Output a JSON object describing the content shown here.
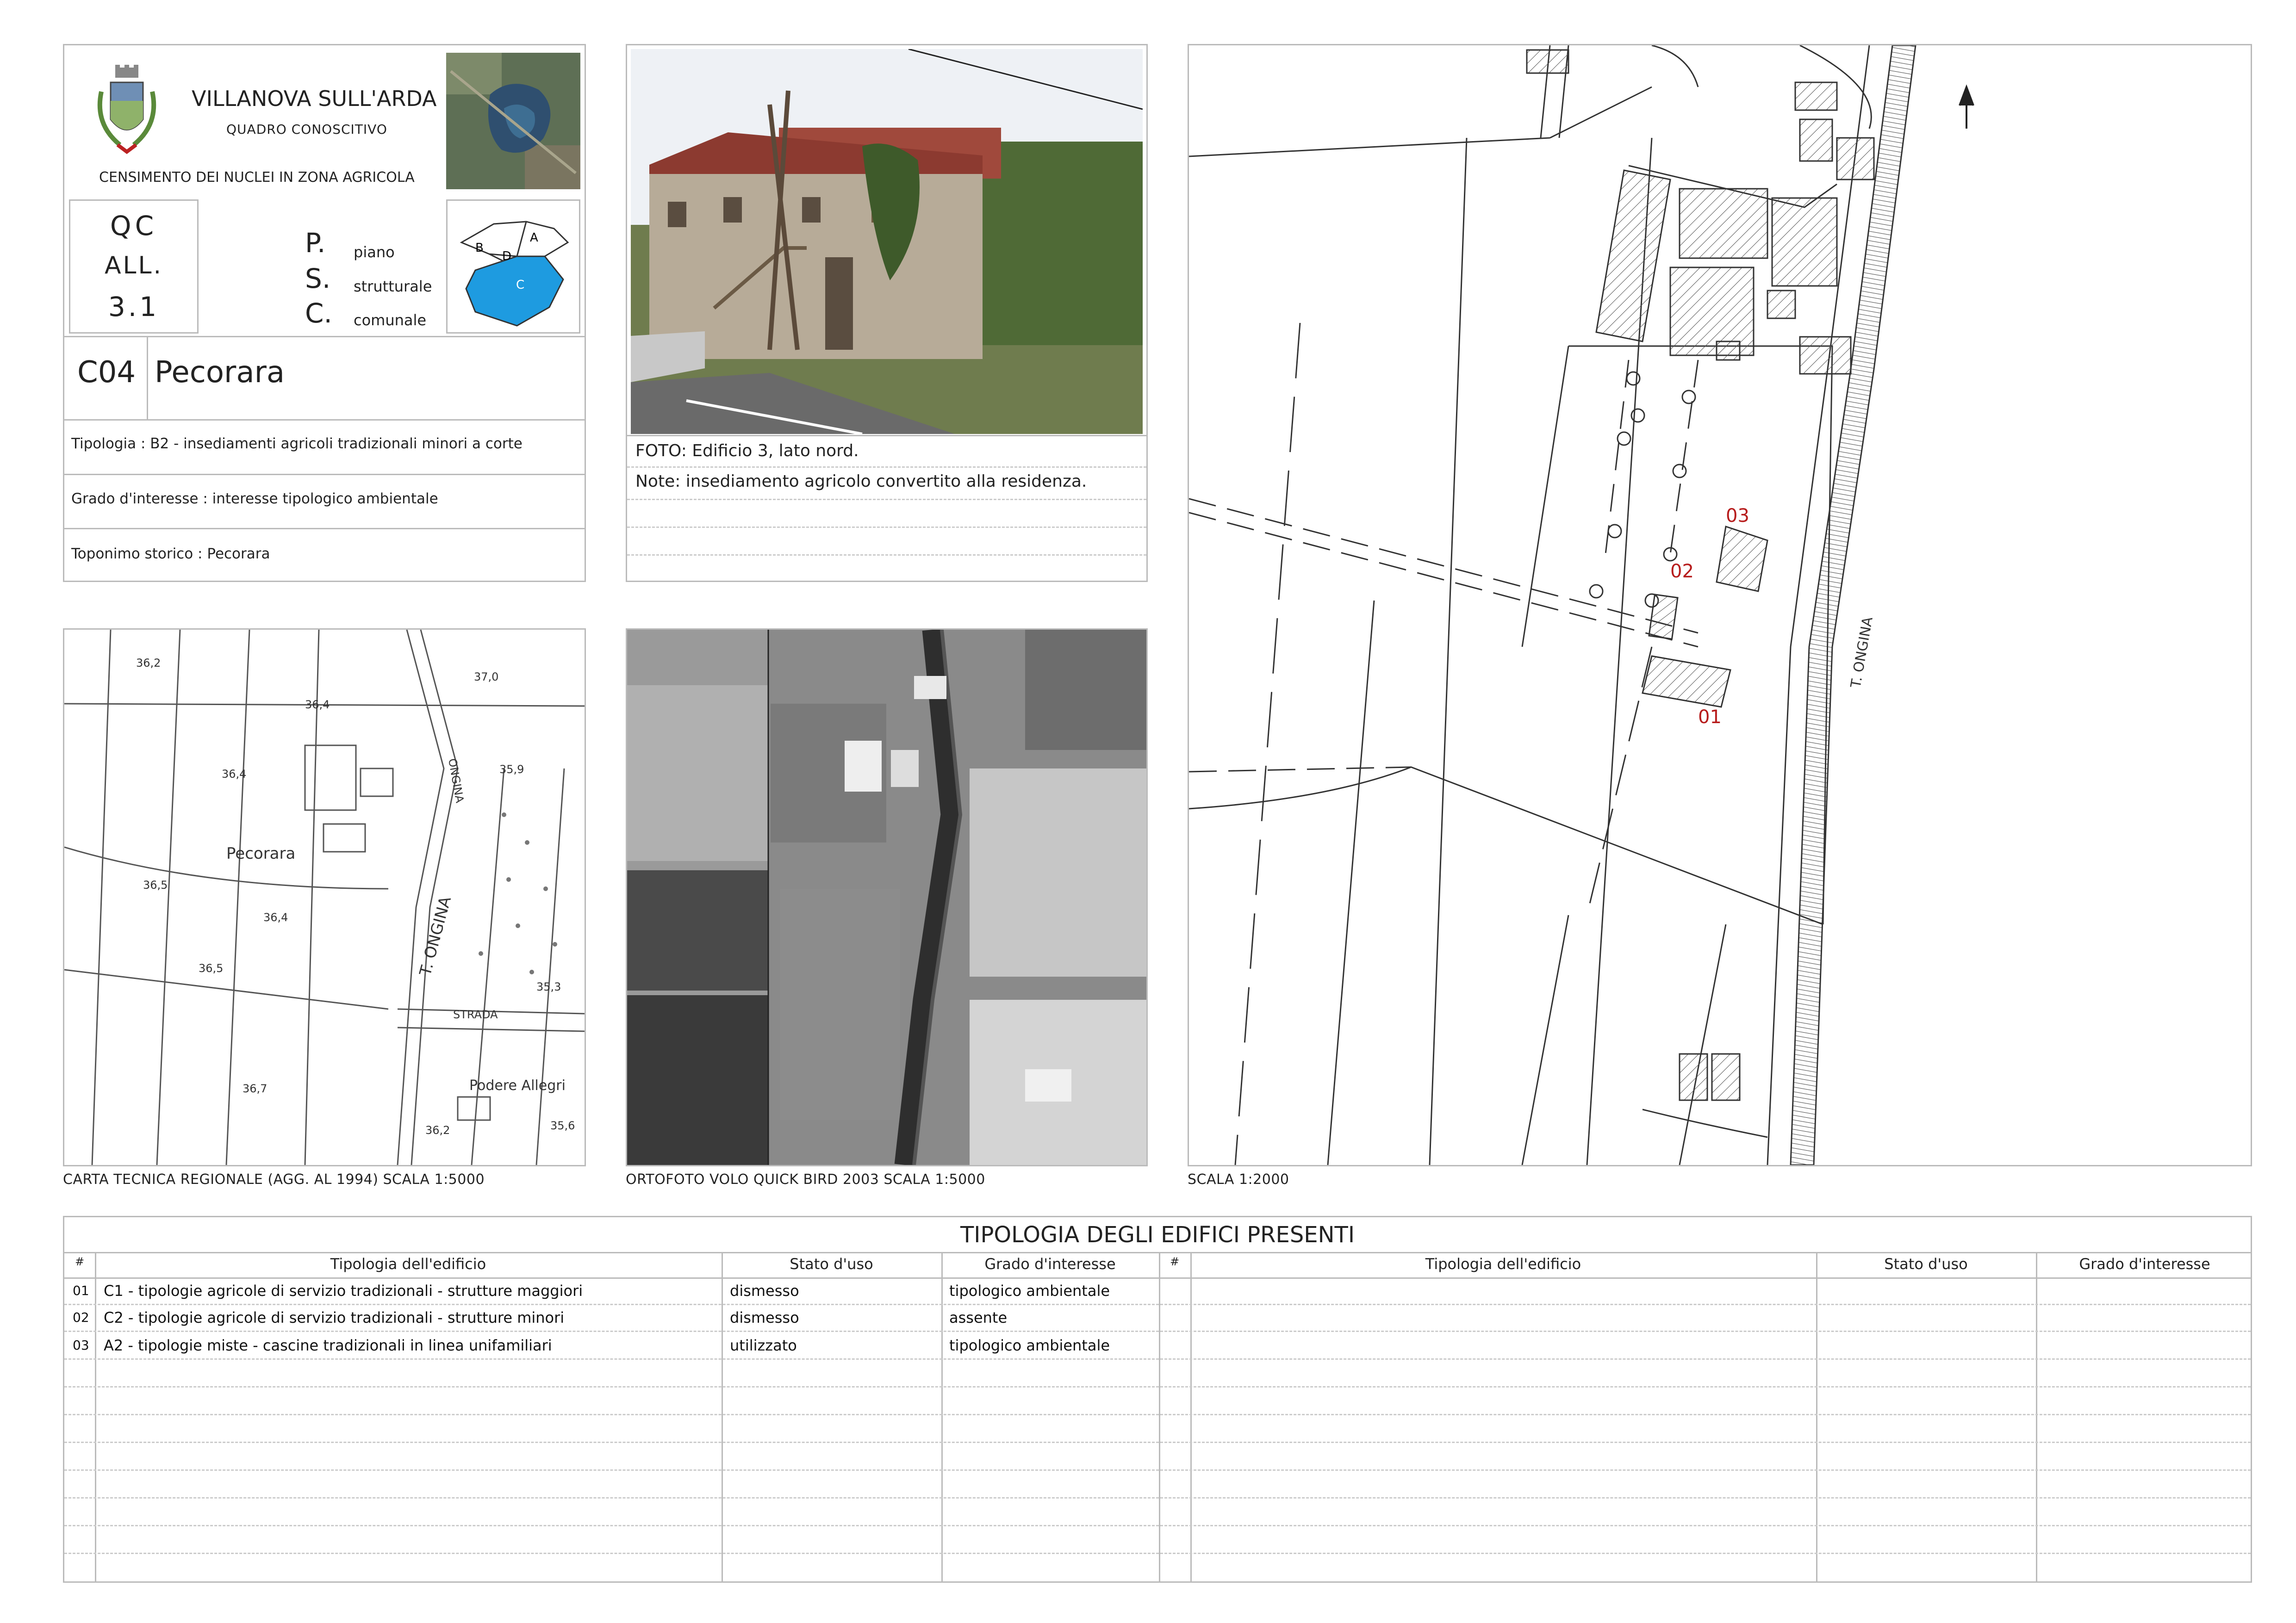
{
  "header": {
    "municipality": "VILLANOVA SULL'ARDA",
    "subtitle": "QUADRO CONOSCITIVO",
    "census": "CENSIMENTO DEI NUCLEI IN ZONA AGRICOLA",
    "qc_line1": "QC",
    "qc_line2": "ALL.",
    "qc_line3": "3.1",
    "psc": [
      {
        "letter": "P.",
        "word": "piano"
      },
      {
        "letter": "S.",
        "word": "strutturale"
      },
      {
        "letter": "C.",
        "word": "comunale"
      }
    ],
    "zone_labels": [
      "A",
      "B",
      "C",
      "D"
    ],
    "code": "C04",
    "name": "Pecorara",
    "rows": [
      "Tipologia : B2 - insediamenti agricoli tradizionali minori a corte",
      "Grado d'interesse : interesse tipologico ambientale",
      "Toponimo storico : Pecorara"
    ]
  },
  "photo": {
    "caption": "FOTO: Edificio 3, lato nord.",
    "note": "Note: insediamento agricolo convertito alla residenza."
  },
  "ctr_map": {
    "caption": "CARTA TECNICA REGIONALE (AGG. AL 1994) SCALA 1:5000",
    "labels": [
      "36,2",
      "36,4",
      "37,0",
      "36,4",
      "35,9",
      "Pecorara",
      "36,5",
      "36,4",
      "36,5",
      "35,3",
      "STRADA",
      "36,7",
      "Podere Allegri",
      "36,2",
      "35,6",
      "T. ONGINA",
      "ONGINA"
    ]
  },
  "ortho": {
    "caption": "ORTOFOTO VOLO QUICK BIRD 2003 SCALA 1:5000"
  },
  "plan": {
    "caption": "SCALA 1:2000",
    "buildings": [
      "01",
      "02",
      "03"
    ],
    "river_label": "T. ONGINA"
  },
  "table": {
    "title": "TIPOLOGIA DEGLI EDIFICI PRESENTI",
    "headers": [
      "#",
      "Tipologia dell'edificio",
      "Stato d'uso",
      "Grado d'interesse"
    ],
    "rows": [
      {
        "n": "01",
        "tipo": "C1 - tipologie agricole di servizio tradizionali - strutture maggiori",
        "stato": "dismesso",
        "grado": "tipologico ambientale"
      },
      {
        "n": "02",
        "tipo": "C2 - tipologie agricole di servizio tradizionali - strutture minori",
        "stato": "dismesso",
        "grado": "assente"
      },
      {
        "n": "03",
        "tipo": "A2 - tipologie miste - cascine tradizionali in linea unifamiliari",
        "stato": "utilizzato",
        "grado": "tipologico ambientale"
      }
    ]
  },
  "colors": {
    "accent_blue": "#1e9be0",
    "label_red": "#b71c1c",
    "border": "#bbbbbb"
  }
}
